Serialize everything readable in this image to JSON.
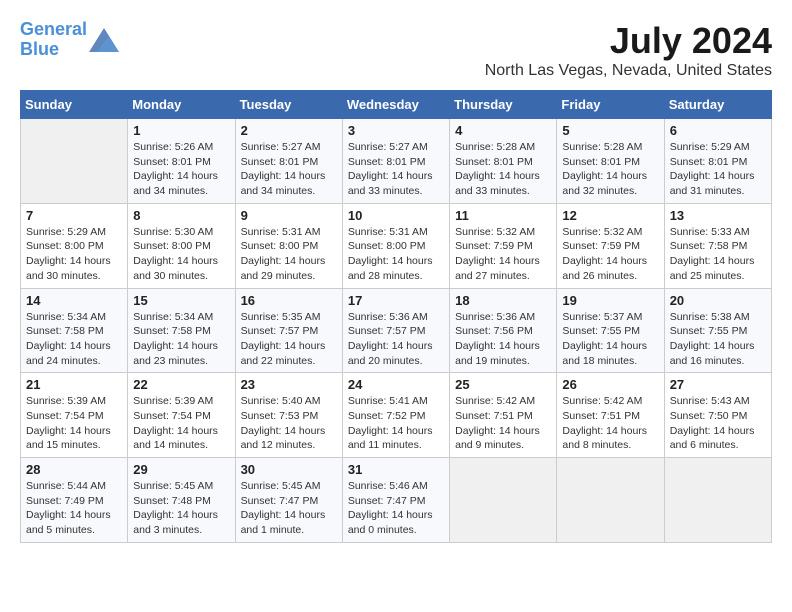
{
  "header": {
    "logo_line1": "General",
    "logo_line2": "Blue",
    "title": "July 2024",
    "subtitle": "North Las Vegas, Nevada, United States"
  },
  "calendar": {
    "days_of_week": [
      "Sunday",
      "Monday",
      "Tuesday",
      "Wednesday",
      "Thursday",
      "Friday",
      "Saturday"
    ],
    "weeks": [
      [
        {
          "date": "",
          "info": ""
        },
        {
          "date": "1",
          "info": "Sunrise: 5:26 AM\nSunset: 8:01 PM\nDaylight: 14 hours\nand 34 minutes."
        },
        {
          "date": "2",
          "info": "Sunrise: 5:27 AM\nSunset: 8:01 PM\nDaylight: 14 hours\nand 34 minutes."
        },
        {
          "date": "3",
          "info": "Sunrise: 5:27 AM\nSunset: 8:01 PM\nDaylight: 14 hours\nand 33 minutes."
        },
        {
          "date": "4",
          "info": "Sunrise: 5:28 AM\nSunset: 8:01 PM\nDaylight: 14 hours\nand 33 minutes."
        },
        {
          "date": "5",
          "info": "Sunrise: 5:28 AM\nSunset: 8:01 PM\nDaylight: 14 hours\nand 32 minutes."
        },
        {
          "date": "6",
          "info": "Sunrise: 5:29 AM\nSunset: 8:01 PM\nDaylight: 14 hours\nand 31 minutes."
        }
      ],
      [
        {
          "date": "7",
          "info": "Sunrise: 5:29 AM\nSunset: 8:00 PM\nDaylight: 14 hours\nand 30 minutes."
        },
        {
          "date": "8",
          "info": "Sunrise: 5:30 AM\nSunset: 8:00 PM\nDaylight: 14 hours\nand 30 minutes."
        },
        {
          "date": "9",
          "info": "Sunrise: 5:31 AM\nSunset: 8:00 PM\nDaylight: 14 hours\nand 29 minutes."
        },
        {
          "date": "10",
          "info": "Sunrise: 5:31 AM\nSunset: 8:00 PM\nDaylight: 14 hours\nand 28 minutes."
        },
        {
          "date": "11",
          "info": "Sunrise: 5:32 AM\nSunset: 7:59 PM\nDaylight: 14 hours\nand 27 minutes."
        },
        {
          "date": "12",
          "info": "Sunrise: 5:32 AM\nSunset: 7:59 PM\nDaylight: 14 hours\nand 26 minutes."
        },
        {
          "date": "13",
          "info": "Sunrise: 5:33 AM\nSunset: 7:58 PM\nDaylight: 14 hours\nand 25 minutes."
        }
      ],
      [
        {
          "date": "14",
          "info": "Sunrise: 5:34 AM\nSunset: 7:58 PM\nDaylight: 14 hours\nand 24 minutes."
        },
        {
          "date": "15",
          "info": "Sunrise: 5:34 AM\nSunset: 7:58 PM\nDaylight: 14 hours\nand 23 minutes."
        },
        {
          "date": "16",
          "info": "Sunrise: 5:35 AM\nSunset: 7:57 PM\nDaylight: 14 hours\nand 22 minutes."
        },
        {
          "date": "17",
          "info": "Sunrise: 5:36 AM\nSunset: 7:57 PM\nDaylight: 14 hours\nand 20 minutes."
        },
        {
          "date": "18",
          "info": "Sunrise: 5:36 AM\nSunset: 7:56 PM\nDaylight: 14 hours\nand 19 minutes."
        },
        {
          "date": "19",
          "info": "Sunrise: 5:37 AM\nSunset: 7:55 PM\nDaylight: 14 hours\nand 18 minutes."
        },
        {
          "date": "20",
          "info": "Sunrise: 5:38 AM\nSunset: 7:55 PM\nDaylight: 14 hours\nand 16 minutes."
        }
      ],
      [
        {
          "date": "21",
          "info": "Sunrise: 5:39 AM\nSunset: 7:54 PM\nDaylight: 14 hours\nand 15 minutes."
        },
        {
          "date": "22",
          "info": "Sunrise: 5:39 AM\nSunset: 7:54 PM\nDaylight: 14 hours\nand 14 minutes."
        },
        {
          "date": "23",
          "info": "Sunrise: 5:40 AM\nSunset: 7:53 PM\nDaylight: 14 hours\nand 12 minutes."
        },
        {
          "date": "24",
          "info": "Sunrise: 5:41 AM\nSunset: 7:52 PM\nDaylight: 14 hours\nand 11 minutes."
        },
        {
          "date": "25",
          "info": "Sunrise: 5:42 AM\nSunset: 7:51 PM\nDaylight: 14 hours\nand 9 minutes."
        },
        {
          "date": "26",
          "info": "Sunrise: 5:42 AM\nSunset: 7:51 PM\nDaylight: 14 hours\nand 8 minutes."
        },
        {
          "date": "27",
          "info": "Sunrise: 5:43 AM\nSunset: 7:50 PM\nDaylight: 14 hours\nand 6 minutes."
        }
      ],
      [
        {
          "date": "28",
          "info": "Sunrise: 5:44 AM\nSunset: 7:49 PM\nDaylight: 14 hours\nand 5 minutes."
        },
        {
          "date": "29",
          "info": "Sunrise: 5:45 AM\nSunset: 7:48 PM\nDaylight: 14 hours\nand 3 minutes."
        },
        {
          "date": "30",
          "info": "Sunrise: 5:45 AM\nSunset: 7:47 PM\nDaylight: 14 hours\nand 1 minute."
        },
        {
          "date": "31",
          "info": "Sunrise: 5:46 AM\nSunset: 7:47 PM\nDaylight: 14 hours\nand 0 minutes."
        },
        {
          "date": "",
          "info": ""
        },
        {
          "date": "",
          "info": ""
        },
        {
          "date": "",
          "info": ""
        }
      ]
    ]
  }
}
